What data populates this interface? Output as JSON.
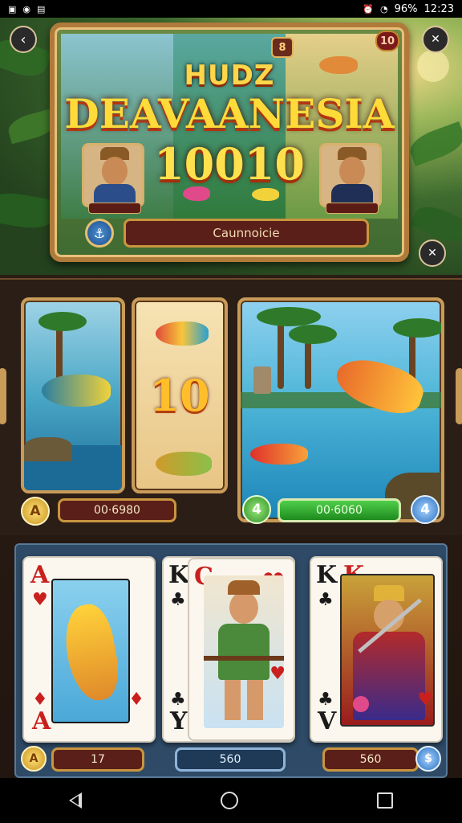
{
  "status_bar": {
    "left_icons": [
      "notification-icon",
      "camera-icon",
      "gallery-icon"
    ],
    "battery": "96%",
    "time": "12:23"
  },
  "banner": {
    "title_line1": "HUDZ",
    "title_line2": "DEAVAANESIA",
    "title_line3": "10010",
    "badge_left": "8",
    "badge_right": "10",
    "bottom_label": "Caunnoicie"
  },
  "mid": {
    "left_amount": "00·6980",
    "left_coin": "A",
    "center_value": "10",
    "right_amount": "00·6060",
    "right_left_badge": "4",
    "right_right_badge": "4"
  },
  "cards": [
    {
      "rank": "A",
      "suit": "♥",
      "color": "red",
      "bottom_rank": "A",
      "bottom_suit": "♦",
      "amount": "17",
      "coin": "A"
    },
    {
      "rank": "K",
      "suit": "♣",
      "color": "black",
      "second_rank": "C",
      "second_suit": "♥",
      "bottom_rank": "Y",
      "bottom_suit": "♣",
      "amount": "560"
    },
    {
      "rank": "K",
      "suit": "♣",
      "color": "black",
      "second_rank": "K",
      "second_suit": "♦",
      "bottom_rank": "V",
      "bottom_suit": "♣",
      "amount": "560",
      "coin": "$"
    }
  ],
  "colors": {
    "gold": "#c99b58",
    "banner_wood": "#b07a3a",
    "card_area": "#2e4a66"
  }
}
